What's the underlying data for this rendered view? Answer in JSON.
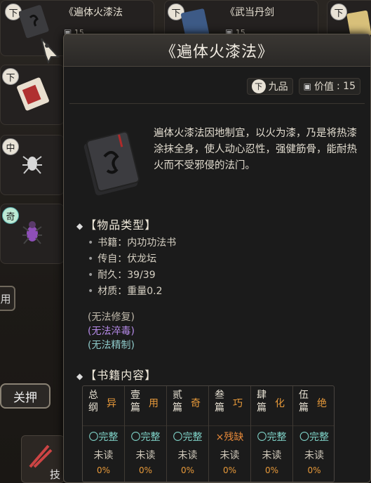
{
  "inventory": {
    "slot1": {
      "grade": "下",
      "title": "《遍体火漆法",
      "value": "15"
    },
    "slot2": {
      "grade": "下",
      "title": "《武当丹剑",
      "value": "15"
    },
    "slot3": {
      "grade": "下"
    },
    "slot4": {
      "grade": "下"
    },
    "slot5": {
      "grade": "中"
    },
    "slot6": {
      "grade": "奇"
    },
    "release_button": "关押",
    "side_tab": "用",
    "bottom_skill": "技"
  },
  "popup": {
    "title": "《遍体火漆法》",
    "grade": "下",
    "grade_text": "九品",
    "price_label": "价值",
    "price": ": 15",
    "description": "遍体火漆法因地制宜，以火为漆，乃是将热漆涂抹全身，使人动心忍性，强健筋骨，能耐热火而不受邪侵的法门。",
    "item_type_title": "【物品类型】",
    "attributes": [
      "书籍：内功功法书",
      "传自：伏龙坛",
      "耐久：39/39",
      "材质：重量0.2"
    ],
    "no_repair": "(无法修复)",
    "no_poison": "(无法淬毒)",
    "no_refine": "(无法精制)",
    "book_content_title": "【书籍内容】",
    "chapters": [
      {
        "name": "总纲",
        "char": "异",
        "status": "〇完整",
        "read": "未读",
        "pct": "0%"
      },
      {
        "name": "壹篇",
        "char": "用",
        "status": "〇完整",
        "read": "未读",
        "pct": "0%"
      },
      {
        "name": "贰篇",
        "char": "奇",
        "status": "〇完整",
        "read": "未读",
        "pct": "0%"
      },
      {
        "name": "叁篇",
        "char": "巧",
        "status": "×残缺",
        "read": "未读",
        "pct": "0%"
      },
      {
        "name": "肆篇",
        "char": "化",
        "status": "〇完整",
        "read": "未读",
        "pct": "0%"
      },
      {
        "name": "伍篇",
        "char": "绝",
        "status": "〇完整",
        "read": "未读",
        "pct": "0%"
      }
    ]
  },
  "colors": {
    "complete": "#7fd3c8",
    "broken": "#e88a3a",
    "no_repair": "#bfb8aa",
    "no_poison": "#b58ae8",
    "no_refine": "#8ec9c9"
  }
}
